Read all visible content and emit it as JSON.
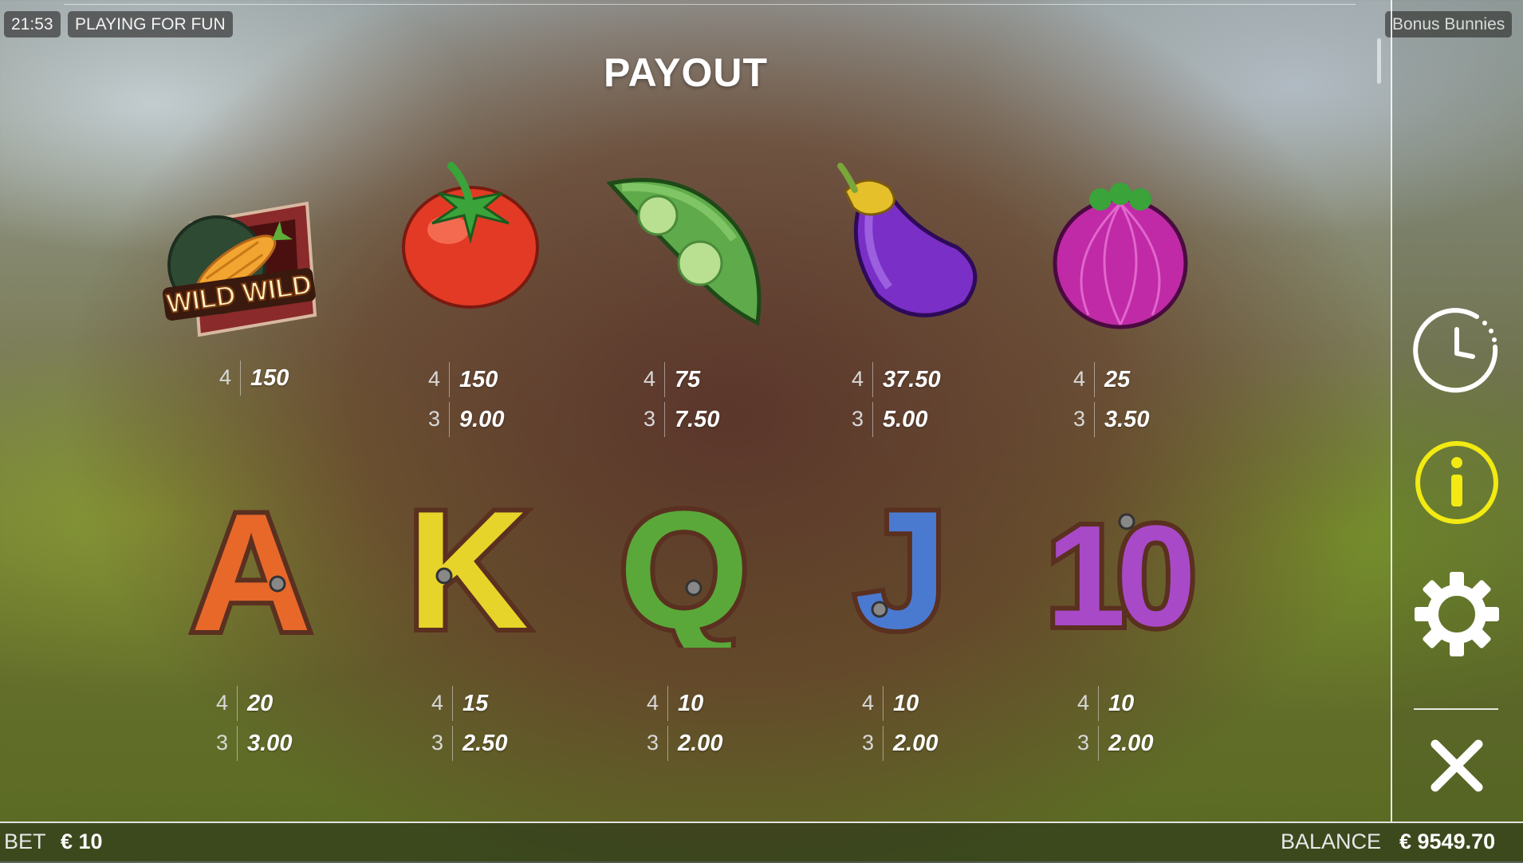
{
  "status": {
    "clock": "21:53",
    "mode": "PLAYING FOR FUN",
    "game_name": "Bonus Bunnies"
  },
  "payout": {
    "title": "PAYOUT",
    "row1": [
      {
        "symbol": "wild-carrot-icon",
        "wild_text": "WILD WILD",
        "pays": [
          {
            "count": "4",
            "value": "150"
          }
        ]
      },
      {
        "symbol": "tomato-icon",
        "pays": [
          {
            "count": "4",
            "value": "150"
          },
          {
            "count": "3",
            "value": "9.00"
          }
        ]
      },
      {
        "symbol": "pea-pod-icon",
        "pays": [
          {
            "count": "4",
            "value": "75"
          },
          {
            "count": "3",
            "value": "7.50"
          }
        ]
      },
      {
        "symbol": "eggplant-icon",
        "pays": [
          {
            "count": "4",
            "value": "37.50"
          },
          {
            "count": "3",
            "value": "5.00"
          }
        ]
      },
      {
        "symbol": "onion-icon",
        "pays": [
          {
            "count": "4",
            "value": "25"
          },
          {
            "count": "3",
            "value": "3.50"
          }
        ]
      }
    ],
    "row2": [
      {
        "symbol": "letter-a-icon",
        "letter": "A",
        "color": "#e8682a",
        "pays": [
          {
            "count": "4",
            "value": "20"
          },
          {
            "count": "3",
            "value": "3.00"
          }
        ]
      },
      {
        "symbol": "letter-k-icon",
        "letter": "K",
        "color": "#e6d42a",
        "pays": [
          {
            "count": "4",
            "value": "15"
          },
          {
            "count": "3",
            "value": "2.50"
          }
        ]
      },
      {
        "symbol": "letter-q-icon",
        "letter": "Q",
        "color": "#5aa83a",
        "pays": [
          {
            "count": "4",
            "value": "10"
          },
          {
            "count": "3",
            "value": "2.00"
          }
        ]
      },
      {
        "symbol": "letter-j-icon",
        "letter": "J",
        "color": "#4a7ad0",
        "pays": [
          {
            "count": "4",
            "value": "10"
          },
          {
            "count": "3",
            "value": "2.00"
          }
        ]
      },
      {
        "symbol": "number-10-icon",
        "letter": "10",
        "color": "#a84ac8",
        "pays": [
          {
            "count": "4",
            "value": "10"
          },
          {
            "count": "3",
            "value": "2.00"
          }
        ]
      }
    ]
  },
  "sidebar": {
    "history_icon": "clock-history-icon",
    "info_icon": "info-icon",
    "info_color": "#f2ea12",
    "settings_icon": "gear-icon",
    "close_icon": "close-icon"
  },
  "footer": {
    "bet_label": "BET",
    "bet_value": "€ 10",
    "balance_label": "BALANCE",
    "balance_value": "€ 9549.70"
  }
}
